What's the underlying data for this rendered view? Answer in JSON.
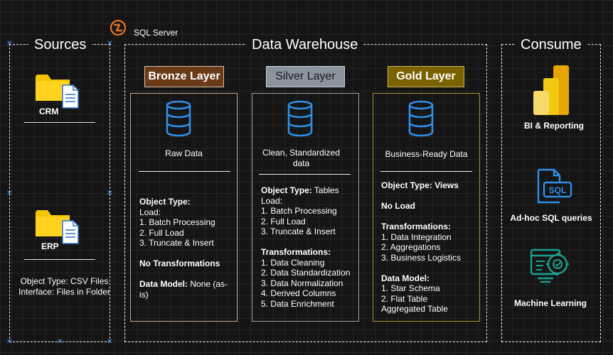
{
  "sql_server": {
    "label": "SQL Server"
  },
  "sources": {
    "title": "Sources",
    "crm_label": "CRM",
    "erp_label": "ERP",
    "object_type": "Object Type: CSV Files",
    "interface": "Interface: Files in Folder"
  },
  "warehouse": {
    "title": "Data Warehouse",
    "bronze": {
      "label": "Bronze Layer",
      "color": "#6b3a17",
      "border": "#c7a78a",
      "description": "Raw Data",
      "object_type_label": "Object Type:",
      "load_label": "Load:",
      "load_items": [
        "1. Batch Processing",
        "2. Full Load",
        "3. Truncate & Insert"
      ],
      "transformations": "No Transformations",
      "data_model_label": "Data Model:",
      "data_model_value": " None (as-is)"
    },
    "silver": {
      "label": "Silver Layer",
      "color": "#8a939e",
      "border": "#9aa3ad",
      "description_line1": "Clean, Standardized",
      "description_line2": "data",
      "object_type_label": "Object Type:",
      "object_type_value": " Tables",
      "load_label": "Load:",
      "load_items": [
        "1. Batch Processing",
        "2. Full Load",
        "3. Truncate & Insert"
      ],
      "transformations_label": "Transformations:",
      "transformation_items": [
        "1. Data Cleaning",
        "2. Data Standardization",
        "3. Data Normalization",
        "4. Derived Columns",
        "5. Data Enrichment"
      ]
    },
    "gold": {
      "label": "Gold Layer",
      "color": "#7a6200",
      "border": "#a8912c",
      "description": "Business-Ready Data",
      "object_type": "Object Type: Views",
      "load": "No Load",
      "transformations_label": "Transformations:",
      "transformation_items": [
        "1. Data Integration",
        "2. Aggregations",
        "3. Business Logistics"
      ],
      "data_model_label": "Data Model:",
      "data_model_items": [
        "1. Star Schema",
        "2. Flat Table",
        "Aggregated Table"
      ]
    }
  },
  "consume": {
    "title": "Consume",
    "bi": "BI & Reporting",
    "sql": "Ad-hoc SQL queries",
    "ml": "Machine Learning"
  }
}
